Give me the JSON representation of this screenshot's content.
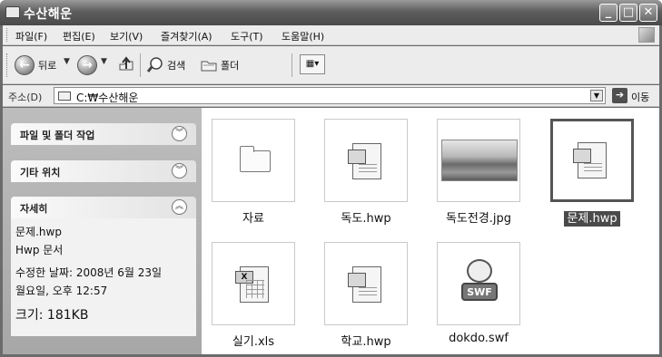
{
  "window": {
    "title": "수산해운",
    "controls": {
      "minimize": "_",
      "maximize": "□",
      "close": "✕"
    }
  },
  "menubar": {
    "items": [
      "파일(F)",
      "편집(E)",
      "보기(V)",
      "즐겨찾기(A)",
      "도구(T)",
      "도움말(H)"
    ]
  },
  "toolbar": {
    "back_label": "뒤로",
    "search_label": "검색",
    "folders_label": "폴더",
    "view_icon": "views-icon"
  },
  "address": {
    "label": "주소(D)",
    "path": "C:₩수산해운",
    "go_label": "이동"
  },
  "taskpane": {
    "panels": [
      {
        "title": "파일 및 폴더 작업",
        "expanded": false
      },
      {
        "title": "기타 위치",
        "expanded": false
      },
      {
        "title": "자세히",
        "expanded": true
      }
    ],
    "details": {
      "name": "문제.hwp",
      "type": "Hwp 문서",
      "modified_line1": "수정한 날짜: 2008년 6월 23일",
      "modified_line2": "월요일, 오후 12:57",
      "size": "크기:  181KB"
    }
  },
  "files": [
    {
      "name": "자료",
      "kind": "folder",
      "selected": false
    },
    {
      "name": "독도.hwp",
      "kind": "hwp",
      "selected": false
    },
    {
      "name": "독도전경.jpg",
      "kind": "jpg",
      "selected": false
    },
    {
      "name": "문제.hwp",
      "kind": "hwp",
      "selected": true
    },
    {
      "name": "실기.xls",
      "kind": "xls",
      "selected": false
    },
    {
      "name": "학교.hwp",
      "kind": "hwp",
      "selected": false
    },
    {
      "name": "dokdo.swf",
      "kind": "swf",
      "selected": false
    }
  ]
}
